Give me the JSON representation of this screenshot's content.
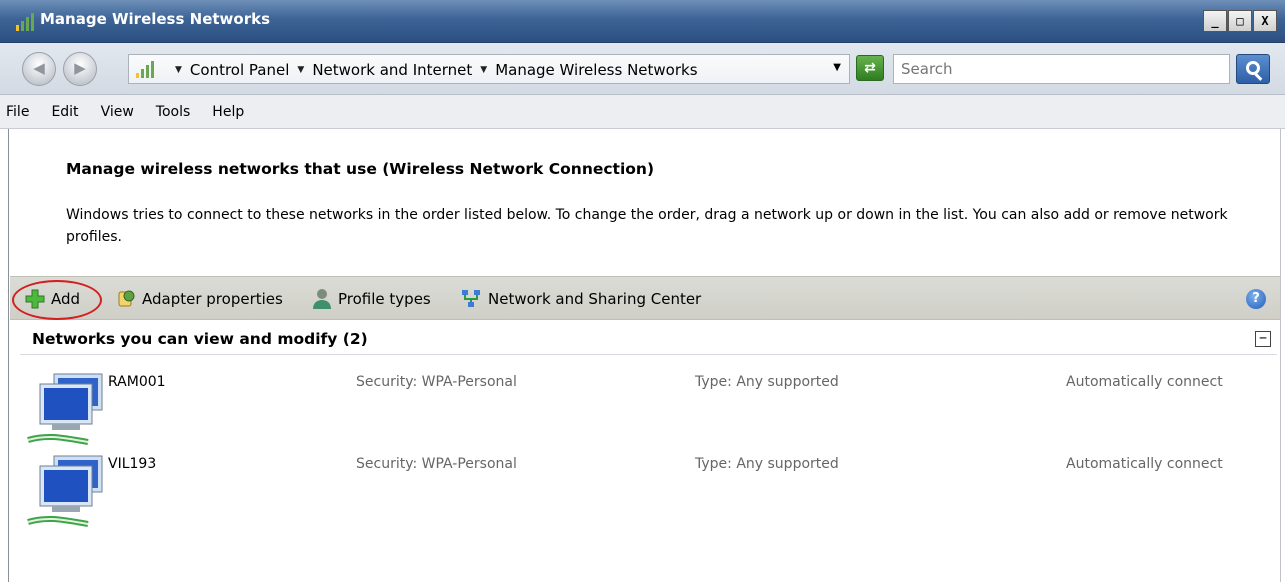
{
  "window": {
    "title": "Manage Wireless Networks",
    "controls": {
      "minimize": "_",
      "maximize": "□",
      "close": "X"
    }
  },
  "address": {
    "crumbs": [
      "Control Panel",
      "Network and Internet",
      "Manage Wireless Networks"
    ],
    "search_placeholder": "Search"
  },
  "menu": [
    "File",
    "Edit",
    "View",
    "Tools",
    "Help"
  ],
  "content": {
    "heading": "Manage wireless networks that use (Wireless Network Connection)",
    "description": "Windows tries to connect to these networks in the order listed below. To change the order, drag a network up or down in the list. You can also add or remove network profiles."
  },
  "toolbar": {
    "add": "Add",
    "adapter_properties": "Adapter properties",
    "profile_types": "Profile types",
    "network_sharing_center": "Network and Sharing Center",
    "help": "?"
  },
  "group": {
    "title": "Networks you can view and modify (2)",
    "collapse": "−"
  },
  "networks": [
    {
      "name": "RAM001",
      "security": "Security: WPA-Personal",
      "type": "Type: Any supported",
      "connect": "Automatically connect"
    },
    {
      "name": "VIL193",
      "security": "Security: WPA-Personal",
      "type": "Type: Any supported",
      "connect": "Automatically connect"
    }
  ],
  "colors": {
    "titlebar": "#3d6496",
    "highlight_ring": "#d21f1f",
    "add_icon": "#3aa62d"
  }
}
